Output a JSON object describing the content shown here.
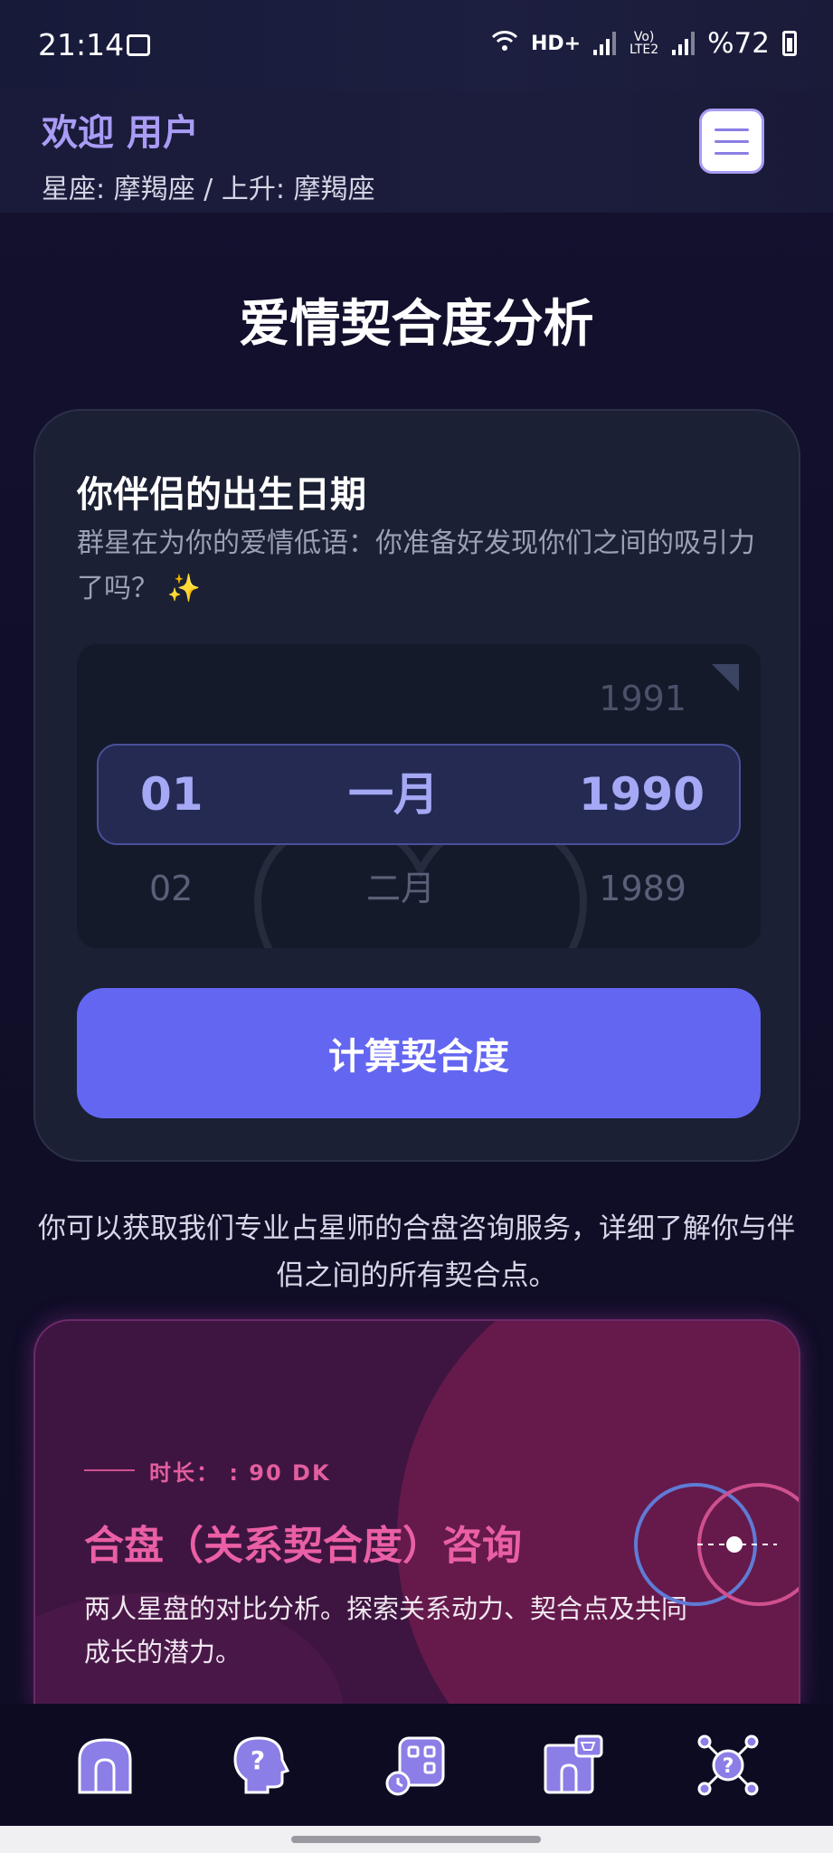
{
  "status_bar": {
    "time": "21:14",
    "network": "HD+",
    "lte": "Vo) LTE2",
    "battery": "%72"
  },
  "header": {
    "welcome": "欢迎 用户",
    "signs": "星座: 摩羯座 / 上升: 摩羯座"
  },
  "page_title": "爱情契合度分析",
  "partner_card": {
    "heading": "你伴侣的出生日期",
    "description": "群星在为你的爱情低语：你准备好发现你们之间的吸引力了吗？ ✨",
    "picker": {
      "above": {
        "year": "1991"
      },
      "selected": {
        "day": "01",
        "month": "一月",
        "year": "1990"
      },
      "below": {
        "day": "02",
        "month": "二月",
        "year": "1989"
      }
    },
    "calculate_label": "计算契合度"
  },
  "info_text": "你可以获取我们专业占星师的合盘咨询服务，详细了解你与伴侣之间的所有契合点。",
  "consultation": {
    "duration": "时长： : 90 DK",
    "title": "合盘（关系契合度）咨询",
    "description": "两人星盘的对比分析。探索关系动力、契合点及共同成长的潜力。"
  },
  "bottom_nav": [
    {
      "icon": "home-icon"
    },
    {
      "icon": "question-head-icon"
    },
    {
      "icon": "apps-grid-icon"
    },
    {
      "icon": "shop-icon"
    },
    {
      "icon": "network-question-icon"
    }
  ],
  "colors": {
    "accent": "#6366f1",
    "header_text": "#a99cf5",
    "consult_title": "#ea5fa5",
    "card_bg": "#1b2034"
  }
}
